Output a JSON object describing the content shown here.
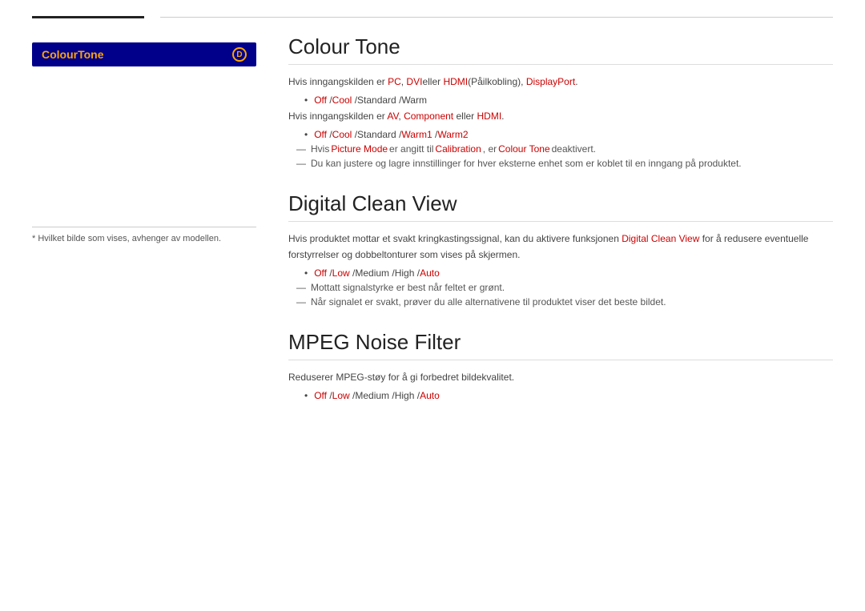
{
  "header": {
    "left_bar": "",
    "right_bar": ""
  },
  "left_panel": {
    "ui_label": "ColourTone",
    "ui_icon": "D",
    "footnote": "* Hvilket bilde som vises, avhenger av modellen."
  },
  "sections": [
    {
      "id": "colour-tone",
      "title": "Colour Tone",
      "paragraphs": [
        {
          "text_before": "Hvis inngangskilden er ",
          "highlights": [
            {
              "text": "PC",
              "color": "red"
            },
            {
              "text": ", ",
              "color": "normal"
            },
            {
              "text": "DVI",
              "color": "red"
            },
            {
              "text": "eller ",
              "color": "normal"
            },
            {
              "text": "HDMI",
              "color": "red"
            },
            {
              "text": "(Påilkobling), ",
              "color": "normal"
            },
            {
              "text": "DisplayPort",
              "color": "red"
            },
            {
              "text": ".",
              "color": "normal"
            }
          ]
        }
      ],
      "bullets": [
        {
          "text_before": "",
          "highlights": [
            {
              "text": "Off",
              "color": "red"
            },
            {
              "text": " /",
              "color": "normal"
            },
            {
              "text": "Cool",
              "color": "red"
            },
            {
              "text": " /Standard /Warm",
              "color": "normal"
            }
          ]
        }
      ],
      "paragraphs2": [
        {
          "text_before": "Hvis inngangskilden er ",
          "highlights": [
            {
              "text": "AV",
              "color": "red"
            },
            {
              "text": ", ",
              "color": "normal"
            },
            {
              "text": "Component",
              "color": "red"
            },
            {
              "text": " eller ",
              "color": "normal"
            },
            {
              "text": "HDMI",
              "color": "red"
            },
            {
              "text": ".",
              "color": "normal"
            }
          ]
        }
      ],
      "bullets2": [
        {
          "highlights": [
            {
              "text": "Off",
              "color": "red"
            },
            {
              "text": " /",
              "color": "normal"
            },
            {
              "text": "Cool",
              "color": "red"
            },
            {
              "text": " /Standard /",
              "color": "normal"
            },
            {
              "text": "Warm1",
              "color": "red"
            },
            {
              "text": " /",
              "color": "normal"
            },
            {
              "text": "Warm2",
              "color": "red"
            }
          ]
        }
      ],
      "notes": [
        "Hvis Picture Mode er angitt til Calibration, er Colour Tone deaktivert.",
        "Du kan justere og lagre innstillinger for hver eksterne enhet som er koblet til en inngang på produktet."
      ]
    },
    {
      "id": "digital-clean-view",
      "title": "Digital Clean View",
      "paragraphs": [
        "Hvis produktet mottar et svakt kringkastingssignal, kan du aktivere funksjonen Digital Clean View for å redusere eventuelle forstyrrelser og dobbeltonturer som vises på skjermen."
      ],
      "bullets": [
        {
          "highlights": [
            {
              "text": "Off",
              "color": "red"
            },
            {
              "text": " /",
              "color": "normal"
            },
            {
              "text": "Low",
              "color": "red"
            },
            {
              "text": " /Medium /High /",
              "color": "normal"
            },
            {
              "text": "Auto",
              "color": "red"
            }
          ]
        }
      ],
      "notes": [
        "Mottatt signalstyrke er best når feltet er grønt.",
        "Når signalet er svakt, prøver du alle alternativene til produktet viser det beste bildet."
      ]
    },
    {
      "id": "mpeg-noise-filter",
      "title": "MPEG Noise Filter",
      "paragraphs": [
        "Reduserer MPEG-støy for å gi forbedret bildekvalitet."
      ],
      "bullets": [
        {
          "highlights": [
            {
              "text": "Off",
              "color": "red"
            },
            {
              "text": " /",
              "color": "normal"
            },
            {
              "text": "Low",
              "color": "red"
            },
            {
              "text": " /Medium /High /",
              "color": "normal"
            },
            {
              "text": "Auto",
              "color": "red"
            }
          ]
        }
      ],
      "notes": []
    }
  ]
}
